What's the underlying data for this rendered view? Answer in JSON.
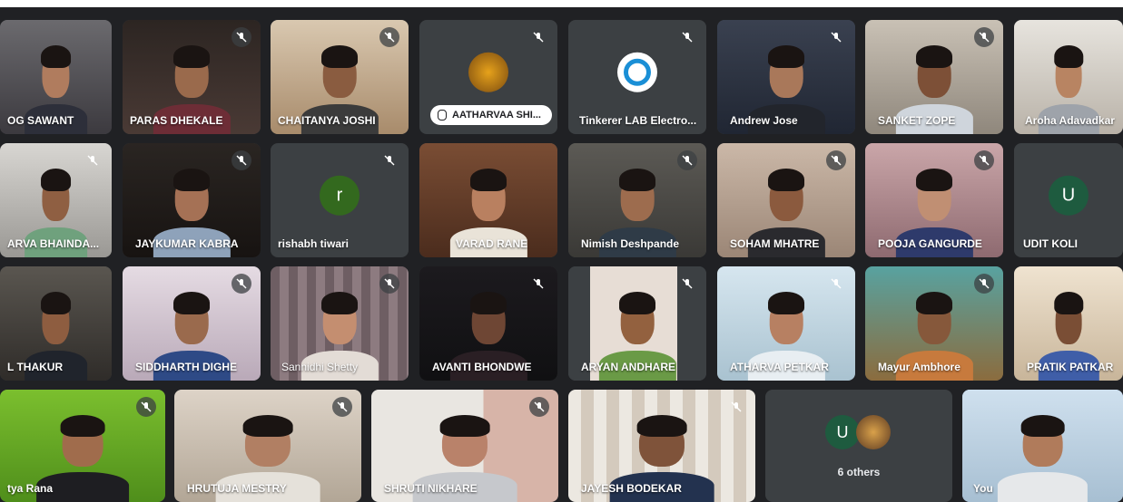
{
  "participants": [
    {
      "name": "OG SAWANT",
      "type": "video",
      "muted": false
    },
    {
      "name": "PARAS DHEKALE",
      "type": "video",
      "muted": true
    },
    {
      "name": "CHAITANYA JOSHI",
      "type": "video",
      "muted": true
    },
    {
      "name": "AATHARVAA SHI...",
      "type": "avatar-image",
      "muted": true
    },
    {
      "name": "Tinkerer LAB Electro...",
      "type": "avatar-image",
      "muted": true
    },
    {
      "name": "Andrew Jose",
      "type": "video",
      "muted": true
    },
    {
      "name": "SANKET ZOPE",
      "type": "video",
      "muted": true
    },
    {
      "name": "Aroha Adavadkar",
      "type": "video",
      "muted": false
    },
    {
      "name": "ARVA BHAINDA...",
      "type": "video",
      "muted": true
    },
    {
      "name": "JAYKUMAR KABRA",
      "type": "video",
      "muted": true
    },
    {
      "name": "rishabh tiwari",
      "type": "letter-avatar",
      "initial": "r",
      "avatar_color": "#33691e",
      "muted": true
    },
    {
      "name": "VARAD RANE",
      "type": "video",
      "muted": false
    },
    {
      "name": "Nimish Deshpande",
      "type": "video",
      "muted": true
    },
    {
      "name": "SOHAM MHATRE",
      "type": "video",
      "muted": true
    },
    {
      "name": "POOJA GANGURDE",
      "type": "video",
      "muted": true
    },
    {
      "name": "UDIT KOLI",
      "type": "letter-avatar",
      "initial": "U",
      "avatar_color": "#1e5b3f",
      "muted": false
    },
    {
      "name": "L THAKUR",
      "type": "video",
      "muted": false
    },
    {
      "name": "SIDDHARTH DIGHE",
      "type": "video",
      "muted": true
    },
    {
      "name": "Sannidhi Shetty",
      "type": "video",
      "muted": true
    },
    {
      "name": "AVANTI BHONDWE",
      "type": "video",
      "muted": true
    },
    {
      "name": "ARYAN ANDHARE",
      "type": "video",
      "muted": true
    },
    {
      "name": "ATHARVA PETKAR",
      "type": "video",
      "muted": true
    },
    {
      "name": "Mayur Ambhore",
      "type": "video",
      "muted": true
    },
    {
      "name": "PRATIK PATKAR",
      "type": "video",
      "muted": false
    },
    {
      "name": "tya Rana",
      "type": "video",
      "muted": true
    },
    {
      "name": "HRUTUJA MESTRY",
      "type": "video",
      "muted": true
    },
    {
      "name": "SHRUTI NIKHARE",
      "type": "video",
      "muted": true
    },
    {
      "name": "JAYESH BODEKAR",
      "type": "video",
      "muted": true
    },
    {
      "name": "6 others",
      "type": "others",
      "initial": "U",
      "avatar_color": "#1e5b3f",
      "muted": false
    },
    {
      "name": "You",
      "type": "video",
      "muted": false
    }
  ],
  "colors": {
    "meeting_bg": "#202124",
    "tile_bg": "#3c4043",
    "self_outline": "#8ab4f8"
  }
}
